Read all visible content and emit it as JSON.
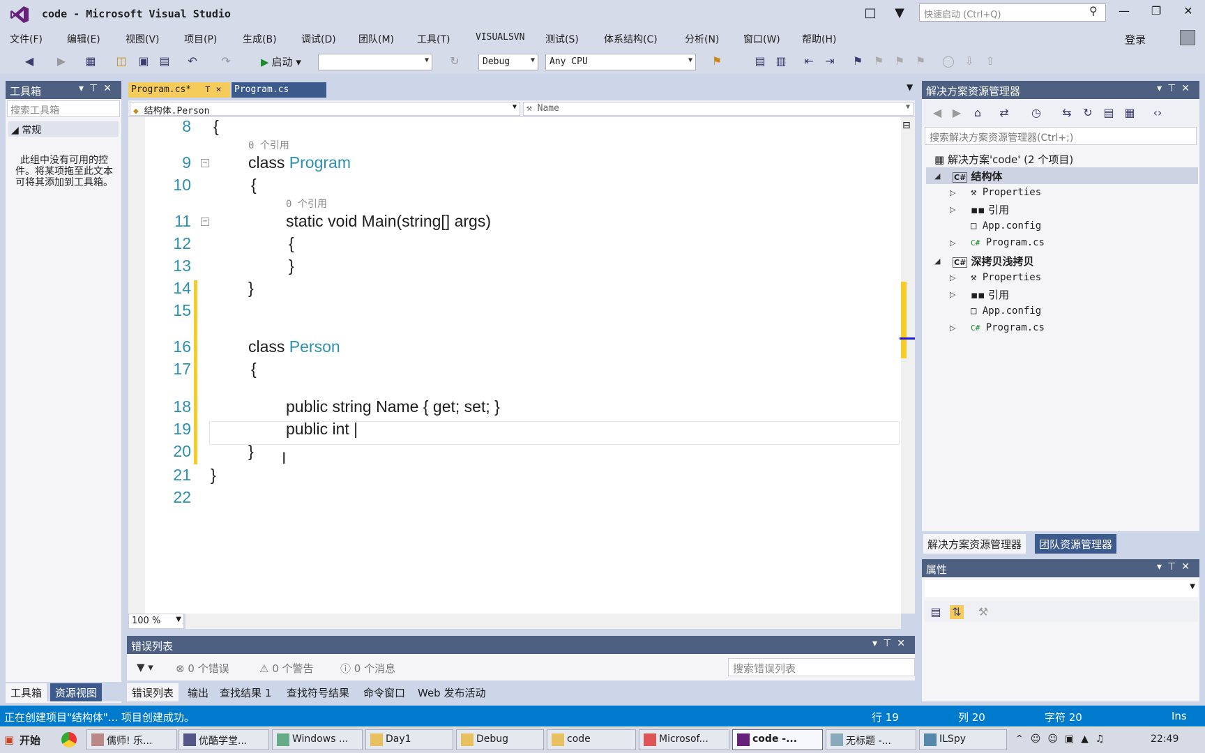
{
  "window": {
    "title": "code - Microsoft Visual Studio",
    "quick_launch_placeholder": "快速启动 (Ctrl+Q)",
    "login": "登录"
  },
  "menu": [
    "文件(F)",
    "编辑(E)",
    "视图(V)",
    "项目(P)",
    "生成(B)",
    "调试(D)",
    "团队(M)",
    "工具(T)",
    "VISUALSVN",
    "测试(S)",
    "体系结构(C)",
    "分析(N)",
    "窗口(W)",
    "帮助(H)"
  ],
  "toolbar": {
    "start_label": "启动",
    "config": "Debug",
    "platform": "Any CPU"
  },
  "toolbox": {
    "title": "工具箱",
    "search_placeholder": "搜索工具箱",
    "group": "常规",
    "empty_text": "此组中没有可用的控件。将某项拖至此文本可将其添加到工具箱。",
    "tabs": [
      "工具箱",
      "资源视图"
    ]
  },
  "editor": {
    "tabs": [
      "Program.cs*",
      "Program.cs"
    ],
    "nav_left": "结构体.Person",
    "nav_right": "Name",
    "zoom": "100 %",
    "ref_label": "0 个引用",
    "lines": [
      {
        "n": "8",
        "code": "{"
      },
      {
        "n": "9",
        "code": "class Program"
      },
      {
        "n": "10",
        "code": "{"
      },
      {
        "n": "11",
        "code": "static void Main(string[] args)"
      },
      {
        "n": "12",
        "code": "{"
      },
      {
        "n": "13",
        "code": "}"
      },
      {
        "n": "14",
        "code": "}"
      },
      {
        "n": "15",
        "code": ""
      },
      {
        "n": "16",
        "code": "class Person"
      },
      {
        "n": "17",
        "code": "{"
      },
      {
        "n": "18",
        "code": "public string Name { get; set; }"
      },
      {
        "n": "19",
        "code": "public int |"
      },
      {
        "n": "20",
        "code": "}"
      },
      {
        "n": "21",
        "code": "}"
      },
      {
        "n": "22",
        "code": ""
      }
    ]
  },
  "errors": {
    "title": "错误列表",
    "errors": "0 个错误",
    "warnings": "0 个警告",
    "messages": "0 个消息",
    "search_placeholder": "搜索错误列表",
    "tabs": [
      "错误列表",
      "输出",
      "查找结果 1",
      "查找符号结果",
      "命令窗口",
      "Web 发布活动"
    ]
  },
  "solution": {
    "title": "解决方案资源管理器",
    "search_placeholder": "搜索解决方案资源管理器(Ctrl+;)",
    "root": "解决方案'code' (2 个项目)",
    "projects": [
      {
        "name": "结构体",
        "items": [
          "Properties",
          "引用",
          "App.config",
          "Program.cs"
        ]
      },
      {
        "name": "深拷贝浅拷贝",
        "items": [
          "Properties",
          "引用",
          "App.config",
          "Program.cs"
        ]
      }
    ],
    "tabs": [
      "解决方案资源管理器",
      "团队资源管理器"
    ]
  },
  "properties": {
    "title": "属性"
  },
  "status": {
    "message": "正在创建项目\"结构体\"... 项目创建成功。",
    "line": "行 19",
    "col": "列 20",
    "ch": "字符 20",
    "mode": "Ins"
  },
  "taskbar": {
    "start": "开始",
    "items": [
      "儒师! 乐...",
      "优酷学堂...",
      "Windows ...",
      "Day1",
      "Debug",
      "code",
      "Microsof...",
      "code -...",
      "无标题 -...",
      "ILSpy"
    ],
    "time": "22:49"
  }
}
